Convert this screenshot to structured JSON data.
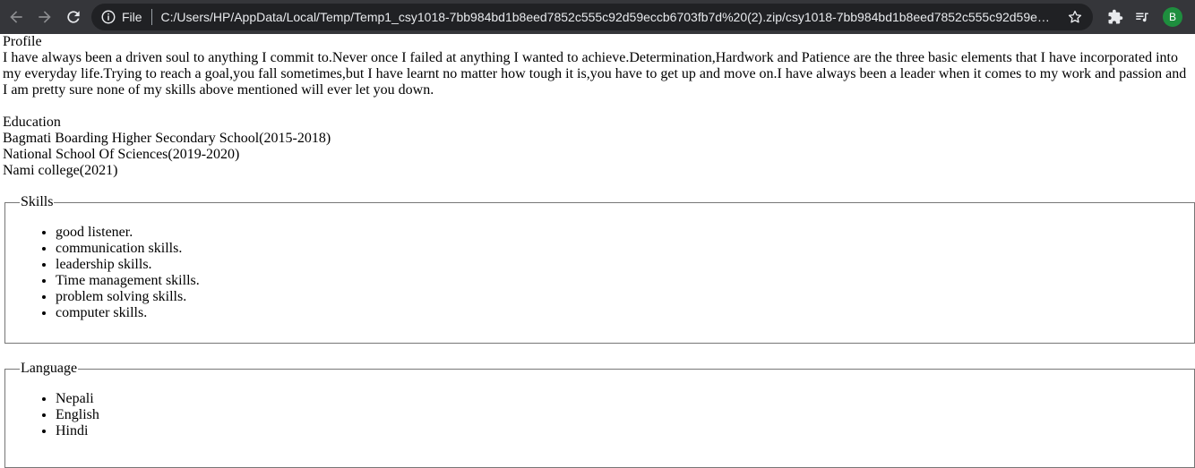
{
  "browser": {
    "scheme": "File",
    "url": "C:/Users/HP/AppData/Local/Temp/Temp1_csy1018-7bb984bd1b8eed7852c555c92d59eccb6703fb7d%20(2).zip/csy1018-7bb984bd1b8eed7852c555c92d59eccb6...",
    "avatar_letter": "B"
  },
  "profile": {
    "heading": "Profile",
    "text": "I have always been a driven soul to anything I commit to.Never once I failed at anything I wanted to achieve.Determination,Hardwork and Patience are the three basic elements that I have incorporated into my everyday life.Trying to reach a goal,you fall sometimes,but I have learnt no matter how tough it is,you have to get up and move on.I have always been a leader when it comes to my work and passion and I am pretty sure none of my skills above mentioned will ever let you down."
  },
  "education": {
    "heading": "Education",
    "items": [
      "Bagmati Boarding Higher Secondary School(2015-2018)",
      "National School Of Sciences(2019-2020)",
      "Nami college(2021)"
    ]
  },
  "skills": {
    "legend": "Skills",
    "items": [
      "good listener.",
      "communication skills.",
      "leadership skills.",
      "Time management skills.",
      "problem solving skills.",
      "computer skills."
    ]
  },
  "language": {
    "legend": "Language",
    "items": [
      "Nepali",
      "English",
      "Hindi"
    ]
  }
}
